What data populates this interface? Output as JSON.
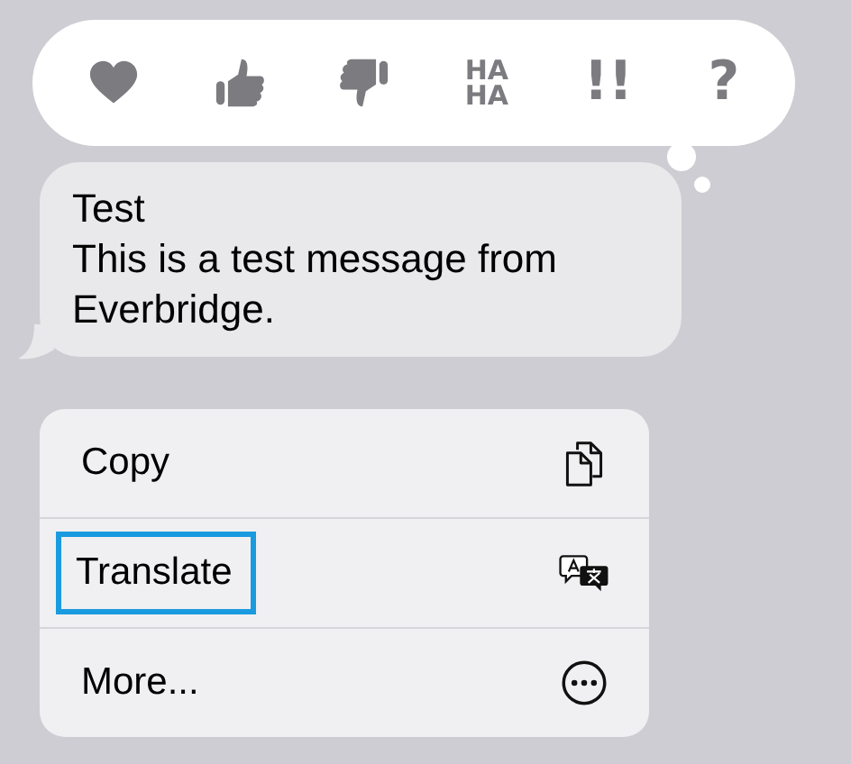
{
  "reactions": [
    {
      "kind": "heart"
    },
    {
      "kind": "thumbs_up"
    },
    {
      "kind": "thumbs_down"
    },
    {
      "kind": "text",
      "lines": [
        "HA",
        "HA"
      ]
    },
    {
      "kind": "text",
      "lines": [
        "!!"
      ]
    },
    {
      "kind": "text",
      "lines": [
        "?"
      ]
    }
  ],
  "message": {
    "lines": [
      "Test",
      "This is a test message from Everbridge."
    ]
  },
  "menu": [
    {
      "label": "Copy",
      "kind": "copy",
      "selected": false
    },
    {
      "label": "Translate",
      "kind": "translate",
      "selected": true
    },
    {
      "label": "More...",
      "kind": "more",
      "selected": false
    }
  ]
}
